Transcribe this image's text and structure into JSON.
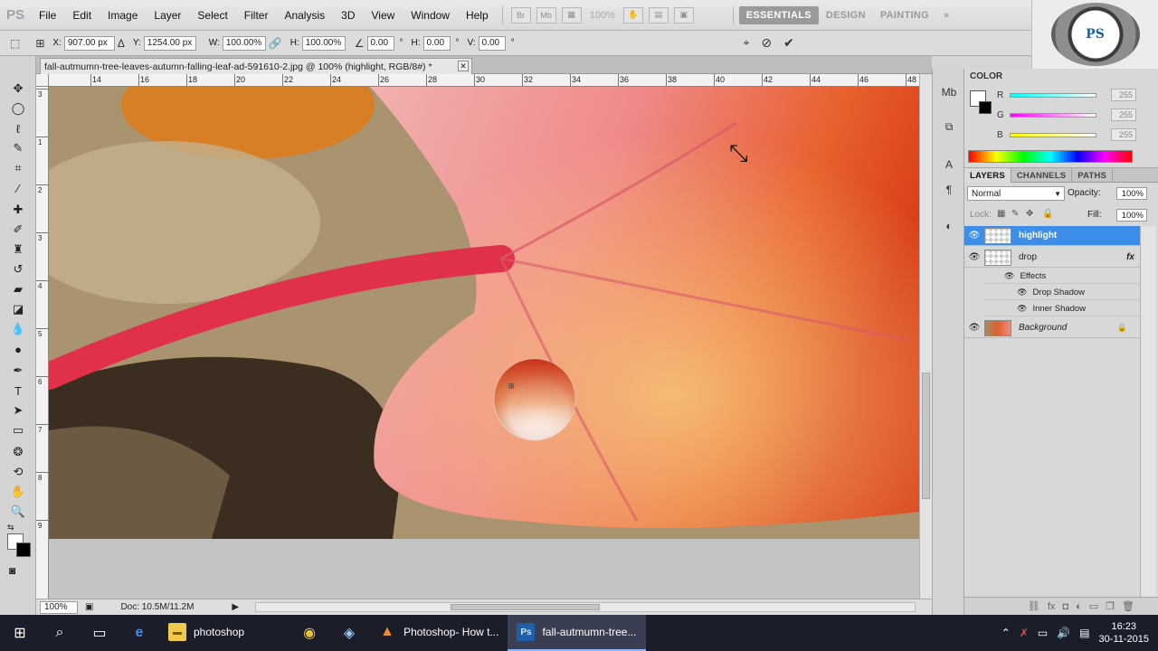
{
  "app": {
    "logo": "PS"
  },
  "menu": [
    "File",
    "Edit",
    "Image",
    "Layer",
    "Select",
    "Filter",
    "Analysis",
    "3D",
    "View",
    "Window",
    "Help"
  ],
  "menubar_zoom": "100%",
  "workspaces": [
    {
      "label": "ESSENTIALS",
      "active": true
    },
    {
      "label": "DESIGN",
      "active": false
    },
    {
      "label": "PAINTING",
      "active": false
    }
  ],
  "options": {
    "x_label": "X:",
    "x_value": "907.00 px",
    "y_label": "Y:",
    "y_value": "1254.00 px",
    "w_label": "W:",
    "w_value": "100.00%",
    "h_label": "H:",
    "h_value": "100.00%",
    "angle_value": "0.00",
    "hskew_label": "H:",
    "hskew_value": "0.00",
    "vskew_label": "V:",
    "vskew_value": "0.00",
    "degree_symbol": "°"
  },
  "document": {
    "tab_title": "fall-autmumn-tree-leaves-autumn-falling-leaf-ad-591610-2.jpg @ 100% (highlight, RGB/8#) *",
    "close_glyph": "✕",
    "zoom": "100%",
    "doc_info": "Doc: 10.5M/11.2M"
  },
  "rulers": {
    "h_ticks": [
      "14",
      "16",
      "18",
      "20",
      "22",
      "24",
      "26",
      "28",
      "30",
      "32",
      "34",
      "36",
      "38",
      "40",
      "42",
      "44",
      "46",
      "48"
    ],
    "v_ticks": [
      "3",
      "1",
      "2",
      "3",
      "4",
      "5",
      "6",
      "7",
      "8",
      "9"
    ]
  },
  "color_panel": {
    "tab": "COLOR",
    "channels": [
      {
        "name": "R",
        "value": "255",
        "color": "#00c8d8"
      },
      {
        "name": "G",
        "value": "255",
        "color": "#e020e0"
      },
      {
        "name": "B",
        "value": "255",
        "color": "#e8e000"
      }
    ]
  },
  "layers_panel": {
    "tabs": [
      "LAYERS",
      "CHANNELS",
      "PATHS"
    ],
    "blend_mode": "Normal",
    "opacity_label": "Opacity:",
    "opacity_value": "100%",
    "lock_label": "Lock:",
    "fill_label": "Fill:",
    "fill_value": "100%",
    "layers": [
      {
        "name": "highlight",
        "selected": true
      },
      {
        "name": "drop",
        "selected": false,
        "fx": "fx"
      },
      {
        "name": "Background",
        "selected": false
      }
    ],
    "effects_label": "Effects",
    "effects": [
      "Drop Shadow",
      "Inner Shadow"
    ]
  },
  "taskbar": {
    "apps": [
      {
        "label": "photoshop",
        "icon": "folder",
        "color": "#f2c94c"
      },
      {
        "label": "Photoshop- How t...",
        "icon": "vlc",
        "color": "#f28c28"
      },
      {
        "label": "fall-autmumn-tree...",
        "icon": "Ps",
        "color": "#1e5fa8"
      }
    ],
    "time": "16:23",
    "date": "30-11-2015"
  }
}
